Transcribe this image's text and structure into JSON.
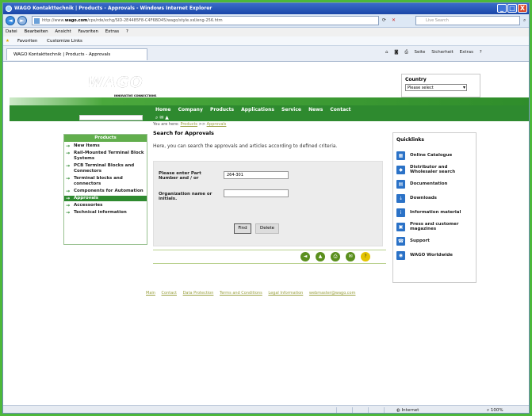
{
  "window": {
    "title": "WAGO Kontakttechnik | Products - Approvals - Windows Internet Explorer",
    "buttons": [
      "_",
      "□",
      "X"
    ]
  },
  "addressbar": {
    "url_prefix": "http://www.",
    "url_domain": "wago.com",
    "url_rest": "/cps/rde/xchg/SID-2E4485F8-C4F6BD45/wago/style.xsl/eng-256.htm",
    "search_placeholder": "Live Search"
  },
  "menu": [
    "Datei",
    "Bearbeiten",
    "Ansicht",
    "Favoriten",
    "Extras",
    "?"
  ],
  "favorites": {
    "label": "Favoriten",
    "link": "Customize Links"
  },
  "tab": {
    "label": "WAGO Kontakttechnik | Products - Approvals"
  },
  "tabtools": [
    "Seite",
    "Sicherheit",
    "Extras"
  ],
  "site": {
    "logo": "WAGO",
    "logo_sub": "INNOVATIVE CONNECTIONS",
    "country_label": "Country",
    "country_select": "Please select",
    "nav": [
      "Home",
      "Company",
      "Products",
      "Applications",
      "Service",
      "News",
      "Contact"
    ]
  },
  "breadcrumb": {
    "prefix": "You are here:",
    "products": "Products",
    "sep": ">>",
    "current": "Approvals"
  },
  "sidebar": {
    "header": "Products",
    "items": [
      {
        "label": "New Items"
      },
      {
        "label": "Rail-Mounted Terminal Block Systems"
      },
      {
        "label": "PCB Terminal Blocks and Connectors"
      },
      {
        "label": "Terminal blocks and connectors"
      },
      {
        "label": "Components for Automation"
      },
      {
        "label": "Approvals"
      },
      {
        "label": "Accessories"
      },
      {
        "label": "Technical information"
      }
    ]
  },
  "main": {
    "title": "Search for Approvals",
    "description": "Here, you can search the approvals and articles according to defined criteria.",
    "field1_label": "Please enter Part Number and / or",
    "field1_value": "264-301",
    "field2_label": "Organization name or initials.",
    "find_label": "Find",
    "delete_label": "Delete"
  },
  "quicklinks": {
    "header": "Quicklinks",
    "items": [
      {
        "label": "Online Catalogue"
      },
      {
        "label": "Distributor and Wholesaler search"
      },
      {
        "label": "Documentation"
      },
      {
        "label": "Downloads"
      },
      {
        "label": "Information material"
      },
      {
        "label": "Press and customer magazines"
      },
      {
        "label": "Support"
      },
      {
        "label": "WAGO Worldwide"
      }
    ]
  },
  "footer": [
    "Main",
    "Contact",
    "Data Protection",
    "Terms and Conditions",
    "Legal Information",
    "webmaster@wago.com"
  ],
  "statusbar": {
    "zone": "Internet",
    "zoom": "100%"
  },
  "colors": {
    "wago_green": "#2e8a2f",
    "ie_blue": "#1a46a8"
  }
}
